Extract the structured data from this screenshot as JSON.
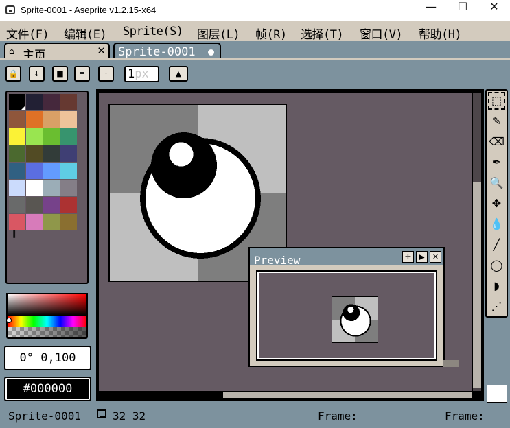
{
  "window": {
    "title": "Sprite-0001 - Aseprite v1.2.15-x64",
    "minimize_glyph": "—",
    "maximize_glyph": "☐",
    "close_glyph": "✕"
  },
  "menu": [
    {
      "label": "文件(F)"
    },
    {
      "label": "编辑(E)"
    },
    {
      "label": "Sprite(S)"
    },
    {
      "label": "图层(L)"
    },
    {
      "label": "帧(R)"
    },
    {
      "label": "选择(T)"
    },
    {
      "label": "窗口(V)"
    },
    {
      "label": "帮助(H)"
    }
  ],
  "tabs": {
    "home": {
      "label": "主页",
      "icon": "home-icon",
      "close_glyph": "✕"
    },
    "sprite": {
      "label": "Sprite-0001",
      "modified": true
    }
  },
  "toolbar": {
    "brush_size": "1",
    "brush_unit": "px",
    "buttons": [
      {
        "name": "lock-icon",
        "glyph": "🔒"
      },
      {
        "name": "arrow-down-icon",
        "glyph": "↓"
      },
      {
        "name": "square-brush-icon",
        "glyph": "■"
      },
      {
        "name": "menu-icon",
        "glyph": "≡"
      },
      {
        "name": "dot-icon",
        "glyph": "·"
      },
      {
        "name": "ink-icon",
        "glyph": "▲"
      }
    ]
  },
  "palette": {
    "colors": [
      "#000000",
      "#222034",
      "#45283c",
      "#663931",
      "#8f563b",
      "#df7126",
      "#d9a066",
      "#eec39a",
      "#fbf236",
      "#99e550",
      "#6abe30",
      "#37946e",
      "#4b692f",
      "#524b24",
      "#323c39",
      "#3f3f74",
      "#306082",
      "#5b6ee1",
      "#639bff",
      "#5fcde4",
      "#cbdbfc",
      "#ffffff",
      "#9badb7",
      "#847e87",
      "#696a6a",
      "#595652",
      "#76428a",
      "#ac3232",
      "#d95763",
      "#d77bba",
      "#8f974a",
      "#8a6f30"
    ],
    "selected_index": 0,
    "handle_glyph": "‖"
  },
  "color": {
    "hsv_label": "0° 0,100",
    "hex_label": "#000000",
    "hue_fraction": 0.0
  },
  "preview": {
    "title": "Preview",
    "buttons": [
      {
        "name": "maximize-preview-icon",
        "glyph": "✛"
      },
      {
        "name": "play-icon",
        "glyph": "▶"
      },
      {
        "name": "close-icon",
        "glyph": "✕"
      }
    ]
  },
  "tools": [
    {
      "name": "marquee-tool-icon",
      "glyph": "⬚",
      "active": true
    },
    {
      "name": "pencil-tool-icon",
      "glyph": "✎"
    },
    {
      "name": "eraser-tool-icon",
      "glyph": "⌫"
    },
    {
      "name": "eyedropper-tool-icon",
      "glyph": "✒"
    },
    {
      "name": "zoom-tool-icon",
      "glyph": "🔍"
    },
    {
      "name": "move-tool-icon",
      "glyph": "✥"
    },
    {
      "name": "fill-tool-icon",
      "glyph": "💧"
    },
    {
      "name": "line-tool-icon",
      "glyph": "╱"
    },
    {
      "name": "ellipse-tool-icon",
      "glyph": "◯"
    },
    {
      "name": "contour-tool-icon",
      "glyph": "◗"
    },
    {
      "name": "spray-tool-icon",
      "glyph": "⋰"
    }
  ],
  "status": {
    "sprite_name": "Sprite-0001",
    "size": "32 32",
    "frame_label": "Frame:",
    "frame_label_right": "Frame:"
  },
  "colors": {
    "accent": "#7d929e",
    "menu_bg": "#d3cbbe",
    "canvas_bg": "#655a63"
  }
}
